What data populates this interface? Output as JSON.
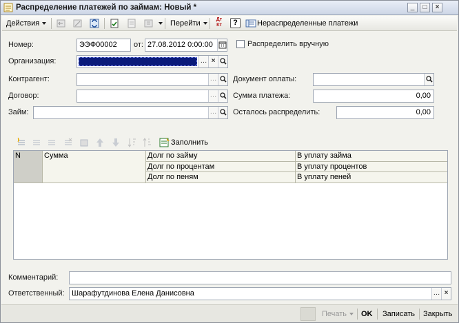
{
  "window": {
    "title": "Распределение платежей по займам: Новый *",
    "controls": {
      "minimize": "_",
      "maximize": "□",
      "close": "×"
    }
  },
  "toolbar": {
    "actions_label": "Действия",
    "goto_label": "Перейти",
    "dtkt_label": "Дт Кт",
    "help_label": "?",
    "unallocated_label": "Нераспределенные платежи"
  },
  "form": {
    "number_label": "Номер:",
    "number_value": "ЭЭФ00002",
    "date_label": "от:",
    "date_value": "27.08.2012  0:00:00",
    "manual_label": "Распределить вручную",
    "org_label": "Организация:",
    "org_value": "",
    "contractor_label": "Контрагент:",
    "contractor_value": "",
    "contract_label": "Договор:",
    "contract_value": "",
    "loan_label": "Займ:",
    "loan_value": "",
    "paydoc_label": "Документ оплаты:",
    "paydoc_value": "",
    "paysum_label": "Сумма платежа:",
    "paysum_value": "0,00",
    "remaining_label": "Осталось распределить:",
    "remaining_value": "0,00"
  },
  "table": {
    "fill_label": "Заполнить",
    "columns": {
      "n": "N",
      "sum": "Сумма",
      "debt_loan": "Долг по займу",
      "debt_interest": "Долг по процентам",
      "debt_penalty": "Долг по пеням",
      "pay_loan": "В уплату займа",
      "pay_interest": "В уплату процентов",
      "pay_penalty": "В уплату пеней"
    }
  },
  "footer": {
    "comment_label": "Комментарий:",
    "comment_value": "",
    "responsible_label": "Ответственный:",
    "responsible_value": "Шарафутдинова Елена Данисовна"
  },
  "buttons": {
    "print": "Печать",
    "ok": "OK",
    "save": "Записать",
    "close": "Закрыть"
  },
  "colors": {
    "selection": "#0a1a7a",
    "window_bg": "#f2f2ed"
  }
}
